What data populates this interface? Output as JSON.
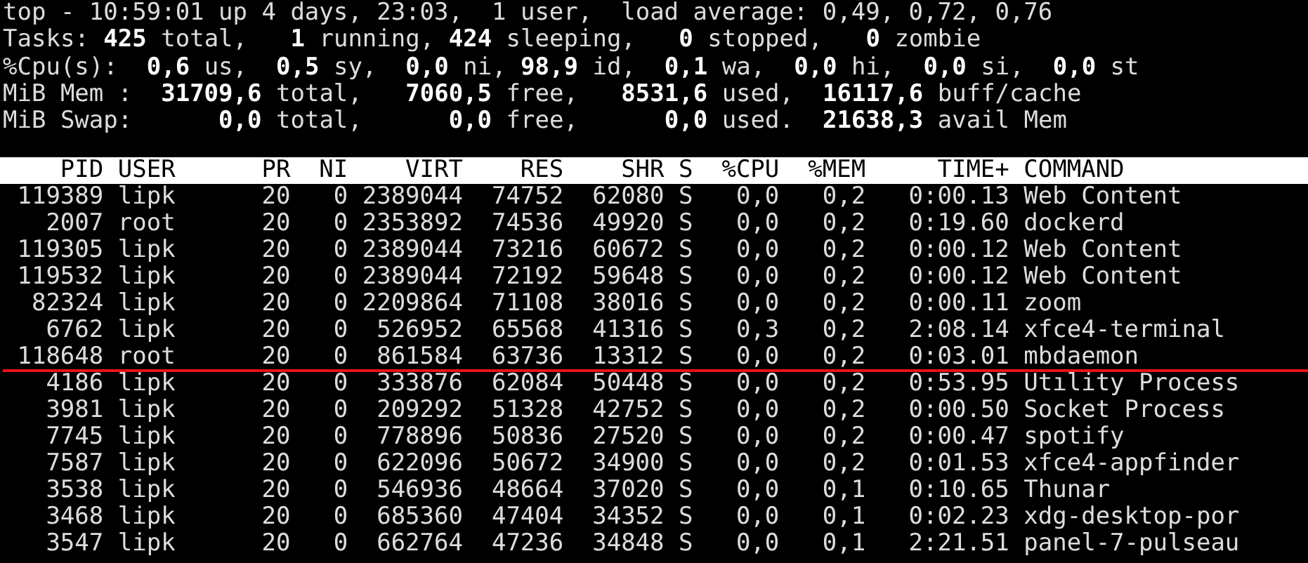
{
  "summary_lines": [
    "top - 10:59:01 up 4 days, 23:03,  1 user,  load average: 0,49, 0,72, 0,76",
    "Tasks: **425** total,   **1** running, **424** sleeping,   **0** stopped,   **0** zombie",
    "%Cpu(s):  **0,6** us,  **0,5** sy,  **0,0** ni, **98,9** id,  **0,1** wa,  **0,0** hi,  **0,0** si,  **0,0** st",
    "MiB Mem :  **31709,6** total,   **7060,5** free,   **8531,6** used,  **16117,6** buff/cache",
    "MiB Swap:      **0,0** total,      **0,0** free,      **0,0** used.  **21638,3** avail Mem"
  ],
  "table": {
    "columns": [
      "PID",
      "USER",
      "PR",
      "NI",
      "VIRT",
      "RES",
      "SHR",
      "S",
      "%CPU",
      "%MEM",
      "TIME+",
      "COMMAND"
    ],
    "rows": [
      {
        "cells": [
          "119389",
          "lipk",
          "20",
          "0",
          "2389044",
          "74752",
          "62080",
          "S",
          "0,0",
          "0,2",
          "0:00.13",
          "Web Content"
        ],
        "underlined": false
      },
      {
        "cells": [
          "2007",
          "root",
          "20",
          "0",
          "2353892",
          "74536",
          "49920",
          "S",
          "0,0",
          "0,2",
          "0:19.60",
          "dockerd"
        ],
        "underlined": false
      },
      {
        "cells": [
          "119305",
          "lipk",
          "20",
          "0",
          "2389044",
          "73216",
          "60672",
          "S",
          "0,0",
          "0,2",
          "0:00.12",
          "Web Content"
        ],
        "underlined": false
      },
      {
        "cells": [
          "119532",
          "lipk",
          "20",
          "0",
          "2389044",
          "72192",
          "59648",
          "S",
          "0,0",
          "0,2",
          "0:00.12",
          "Web Content"
        ],
        "underlined": false
      },
      {
        "cells": [
          "82324",
          "lipk",
          "20",
          "0",
          "2209864",
          "71108",
          "38016",
          "S",
          "0,0",
          "0,2",
          "0:00.11",
          "zoom"
        ],
        "underlined": false
      },
      {
        "cells": [
          "6762",
          "lipk",
          "20",
          "0",
          "526952",
          "65568",
          "41316",
          "S",
          "0,3",
          "0,2",
          "2:08.14",
          "xfce4-terminal"
        ],
        "underlined": false
      },
      {
        "cells": [
          "118648",
          "root",
          "20",
          "0",
          "861584",
          "63736",
          "13312",
          "S",
          "0,0",
          "0,2",
          "0:03.01",
          "mbdaemon"
        ],
        "underlined": true
      },
      {
        "cells": [
          "4186",
          "lipk",
          "20",
          "0",
          "333876",
          "62084",
          "50448",
          "S",
          "0,0",
          "0,2",
          "0:53.95",
          "Utılity Process"
        ],
        "underlined": false
      },
      {
        "cells": [
          "3981",
          "lipk",
          "20",
          "0",
          "209292",
          "51328",
          "42752",
          "S",
          "0,0",
          "0,2",
          "0:00.50",
          "Socket Process"
        ],
        "underlined": false
      },
      {
        "cells": [
          "7745",
          "lipk",
          "20",
          "0",
          "778896",
          "50836",
          "27520",
          "S",
          "0,0",
          "0,2",
          "0:00.47",
          "spotify"
        ],
        "underlined": false
      },
      {
        "cells": [
          "7587",
          "lipk",
          "20",
          "0",
          "622096",
          "50672",
          "34900",
          "S",
          "0,0",
          "0,2",
          "0:01.53",
          "xfce4-appfinder"
        ],
        "underlined": false
      },
      {
        "cells": [
          "3538",
          "lipk",
          "20",
          "0",
          "546936",
          "48664",
          "37020",
          "S",
          "0,0",
          "0,1",
          "0:10.65",
          "Thunar"
        ],
        "underlined": false
      },
      {
        "cells": [
          "3468",
          "lipk",
          "20",
          "0",
          "685360",
          "47404",
          "34352",
          "S",
          "0,0",
          "0,1",
          "0:02.23",
          "xdg-desktop-por"
        ],
        "underlined": false
      },
      {
        "cells": [
          "3547",
          "lipk",
          "20",
          "0",
          "662764",
          "47236",
          "34848",
          "S",
          "0,0",
          "0,1",
          "2:21.51",
          "panel-7-pulseau"
        ],
        "underlined": false
      }
    ]
  }
}
